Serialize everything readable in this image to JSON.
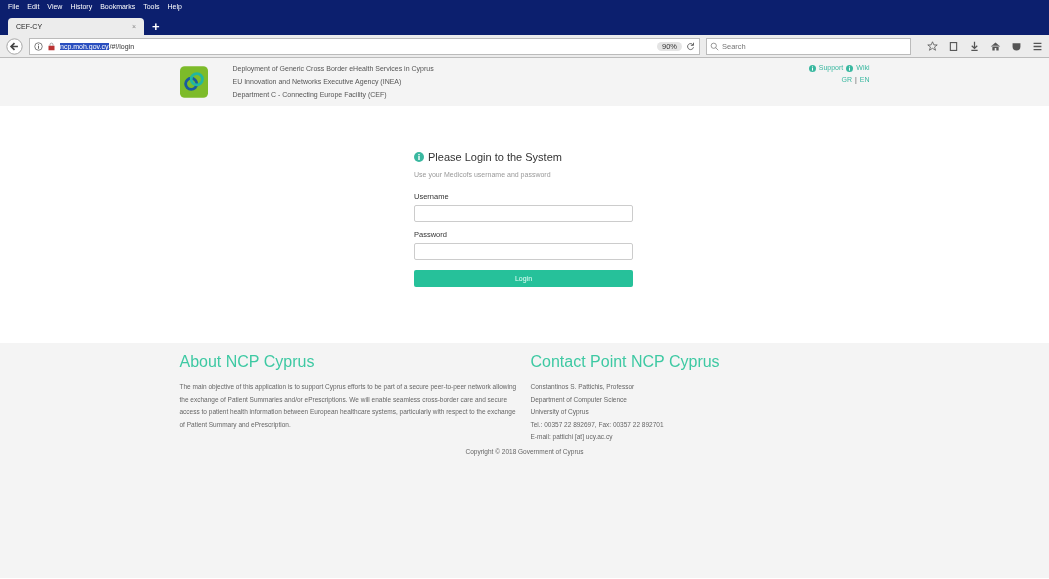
{
  "browser": {
    "menu": [
      "File",
      "Edit",
      "View",
      "History",
      "Bookmarks",
      "Tools",
      "Help"
    ],
    "tabs": [
      {
        "title": "CEF-CY",
        "close": "×",
        "selected": true
      }
    ],
    "new_tab": "+",
    "url": {
      "host": "ncp.moh.gov.cy",
      "path": "/#!/login",
      "host_selected": true
    },
    "zoom": "90%",
    "search": {
      "placeholder": "Search"
    }
  },
  "header": {
    "lines": [
      "Deployment of Generic Cross Border eHealth Services in Cyprus",
      "EU Innovation and Networks Executive Agency (INEA)",
      "Department C - Connecting Europe Facility (CEF)"
    ],
    "links": [
      "Support",
      "Wiki"
    ],
    "languages": [
      "GR",
      "EN"
    ],
    "language_separator": "|"
  },
  "login": {
    "title": "Please Login to the System",
    "hint": "Use your Medicofs username and password",
    "fields": [
      {
        "label": "Username"
      },
      {
        "label": "Password"
      }
    ],
    "button": "Login"
  },
  "about": {
    "title": "About NCP Cyprus",
    "text": "The main objective of this application is to support Cyprus efforts to be part of a secure peer-to-peer network allowing the exchange of Patient Summaries and/or ePrescriptions. We will enable seamless cross-border care and secure access to patient health information between European healthcare systems, particularly with respect to the exchange of Patient Summary and ePrescription."
  },
  "contact": {
    "title": "Contact Point NCP Cyprus",
    "lines": [
      "Constantinos S. Pattichis, Professor",
      "Department of Computer Science",
      "University of Cyprus",
      "Tel.: 00357 22 892697, Fax: 00357 22 892701",
      "E-mail: pattichi [at] ucy.ac.cy"
    ]
  },
  "copyright": "Copyright © 2018 Government of Cyprus"
}
